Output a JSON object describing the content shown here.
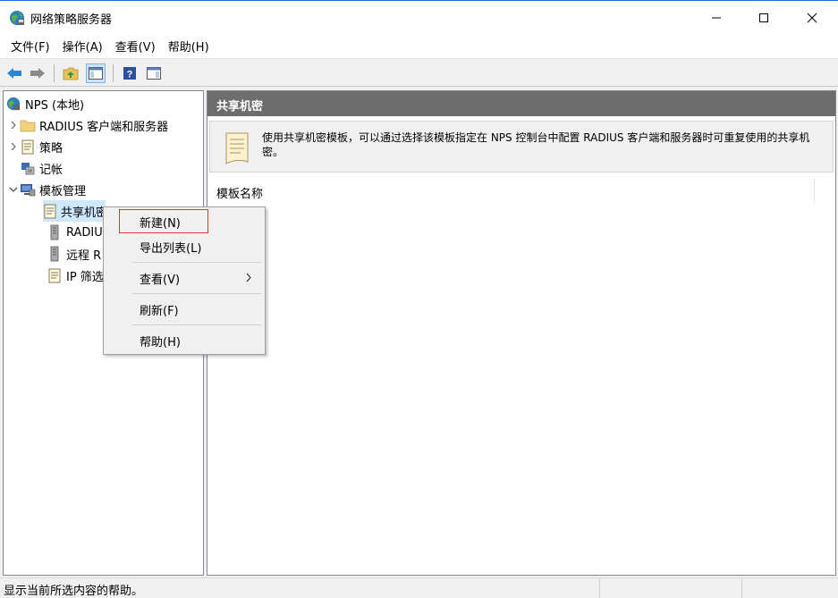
{
  "window": {
    "title": "网络策略服务器"
  },
  "menu": [
    "文件(F)",
    "操作(A)",
    "查看(V)",
    "帮助(H)"
  ],
  "tree": {
    "root": "NPS (本地)",
    "items": [
      {
        "label": "RADIUS 客户端和服务器",
        "icon": "folder-icon"
      },
      {
        "label": "策略",
        "icon": "policy-icon"
      },
      {
        "label": "记帐",
        "icon": "accounting-icon"
      },
      {
        "label": "模板管理",
        "icon": "template-management-icon"
      },
      {
        "label": "共享机密",
        "icon": "shared-secret-icon"
      },
      {
        "label": "RADIU",
        "icon": "server-icon"
      },
      {
        "label": "远程 R",
        "icon": "server-icon"
      },
      {
        "label": "IP 筛选",
        "icon": "filter-icon"
      }
    ]
  },
  "right": {
    "header": "共享机密",
    "description": "使用共享机密模板，可以通过选择该模板指定在 NPS 控制台中配置 RADIUS 客户端和服务器时可重复使用的共享机密。",
    "column": "模板名称"
  },
  "context_menu": {
    "items": [
      "新建(N)",
      "导出列表(L)",
      "查看(V)",
      "刷新(F)",
      "帮助(H)"
    ]
  },
  "status": {
    "text": "显示当前所选内容的帮助。"
  },
  "colors": {
    "accent": "#1e6fd0",
    "header_bg": "#6d6d6d",
    "highlight_border": "#e0322f"
  }
}
